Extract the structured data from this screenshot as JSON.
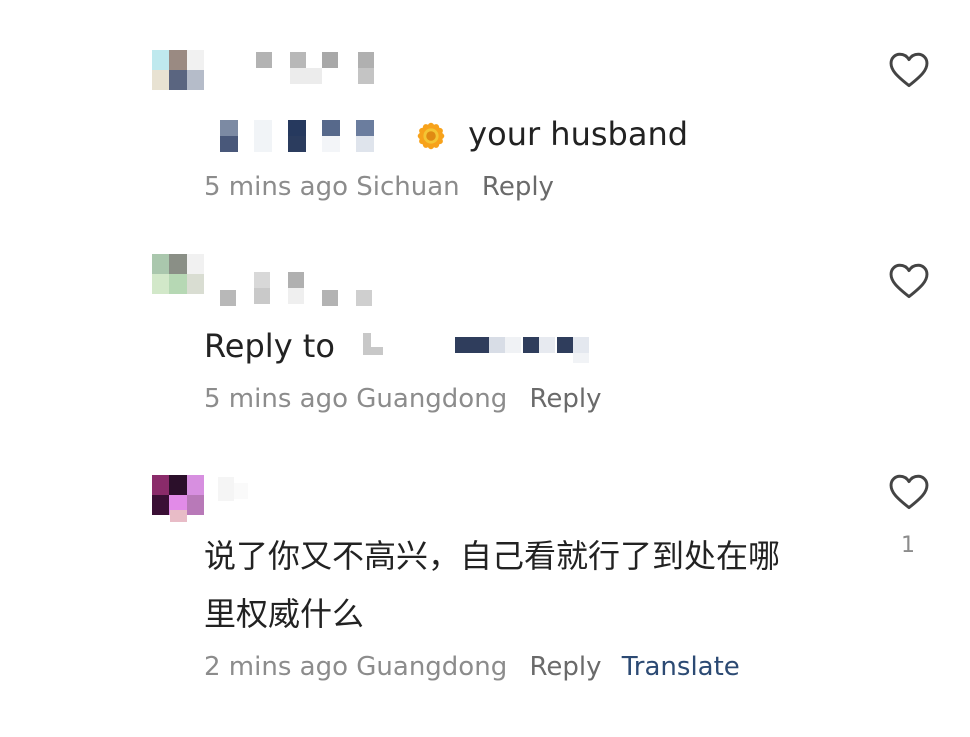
{
  "comments": [
    {
      "text": "your husband",
      "time": "5 mins ago",
      "location": "Sichuan",
      "reply_label": "Reply",
      "icon": "flower-emoji"
    },
    {
      "reply_to_prefix": "Reply to",
      "time": "5 mins ago",
      "location": "Guangdong",
      "reply_label": "Reply"
    },
    {
      "text": "说了你又不高兴，自己看就行了到处在哪里权威什么",
      "line1": "说了你又不高兴，自己看就行了到处在哪",
      "line2": "里权威什么",
      "time": "2 mins ago",
      "location": "Guangdong",
      "reply_label": "Reply",
      "translate_label": "Translate",
      "likes": "1"
    }
  ],
  "colors": {
    "text": "#222222",
    "meta": "#8c8c8c",
    "translate": "#2c4a73",
    "heart_stroke": "#444444"
  },
  "icons": [
    "heart-icon",
    "flower-icon"
  ]
}
